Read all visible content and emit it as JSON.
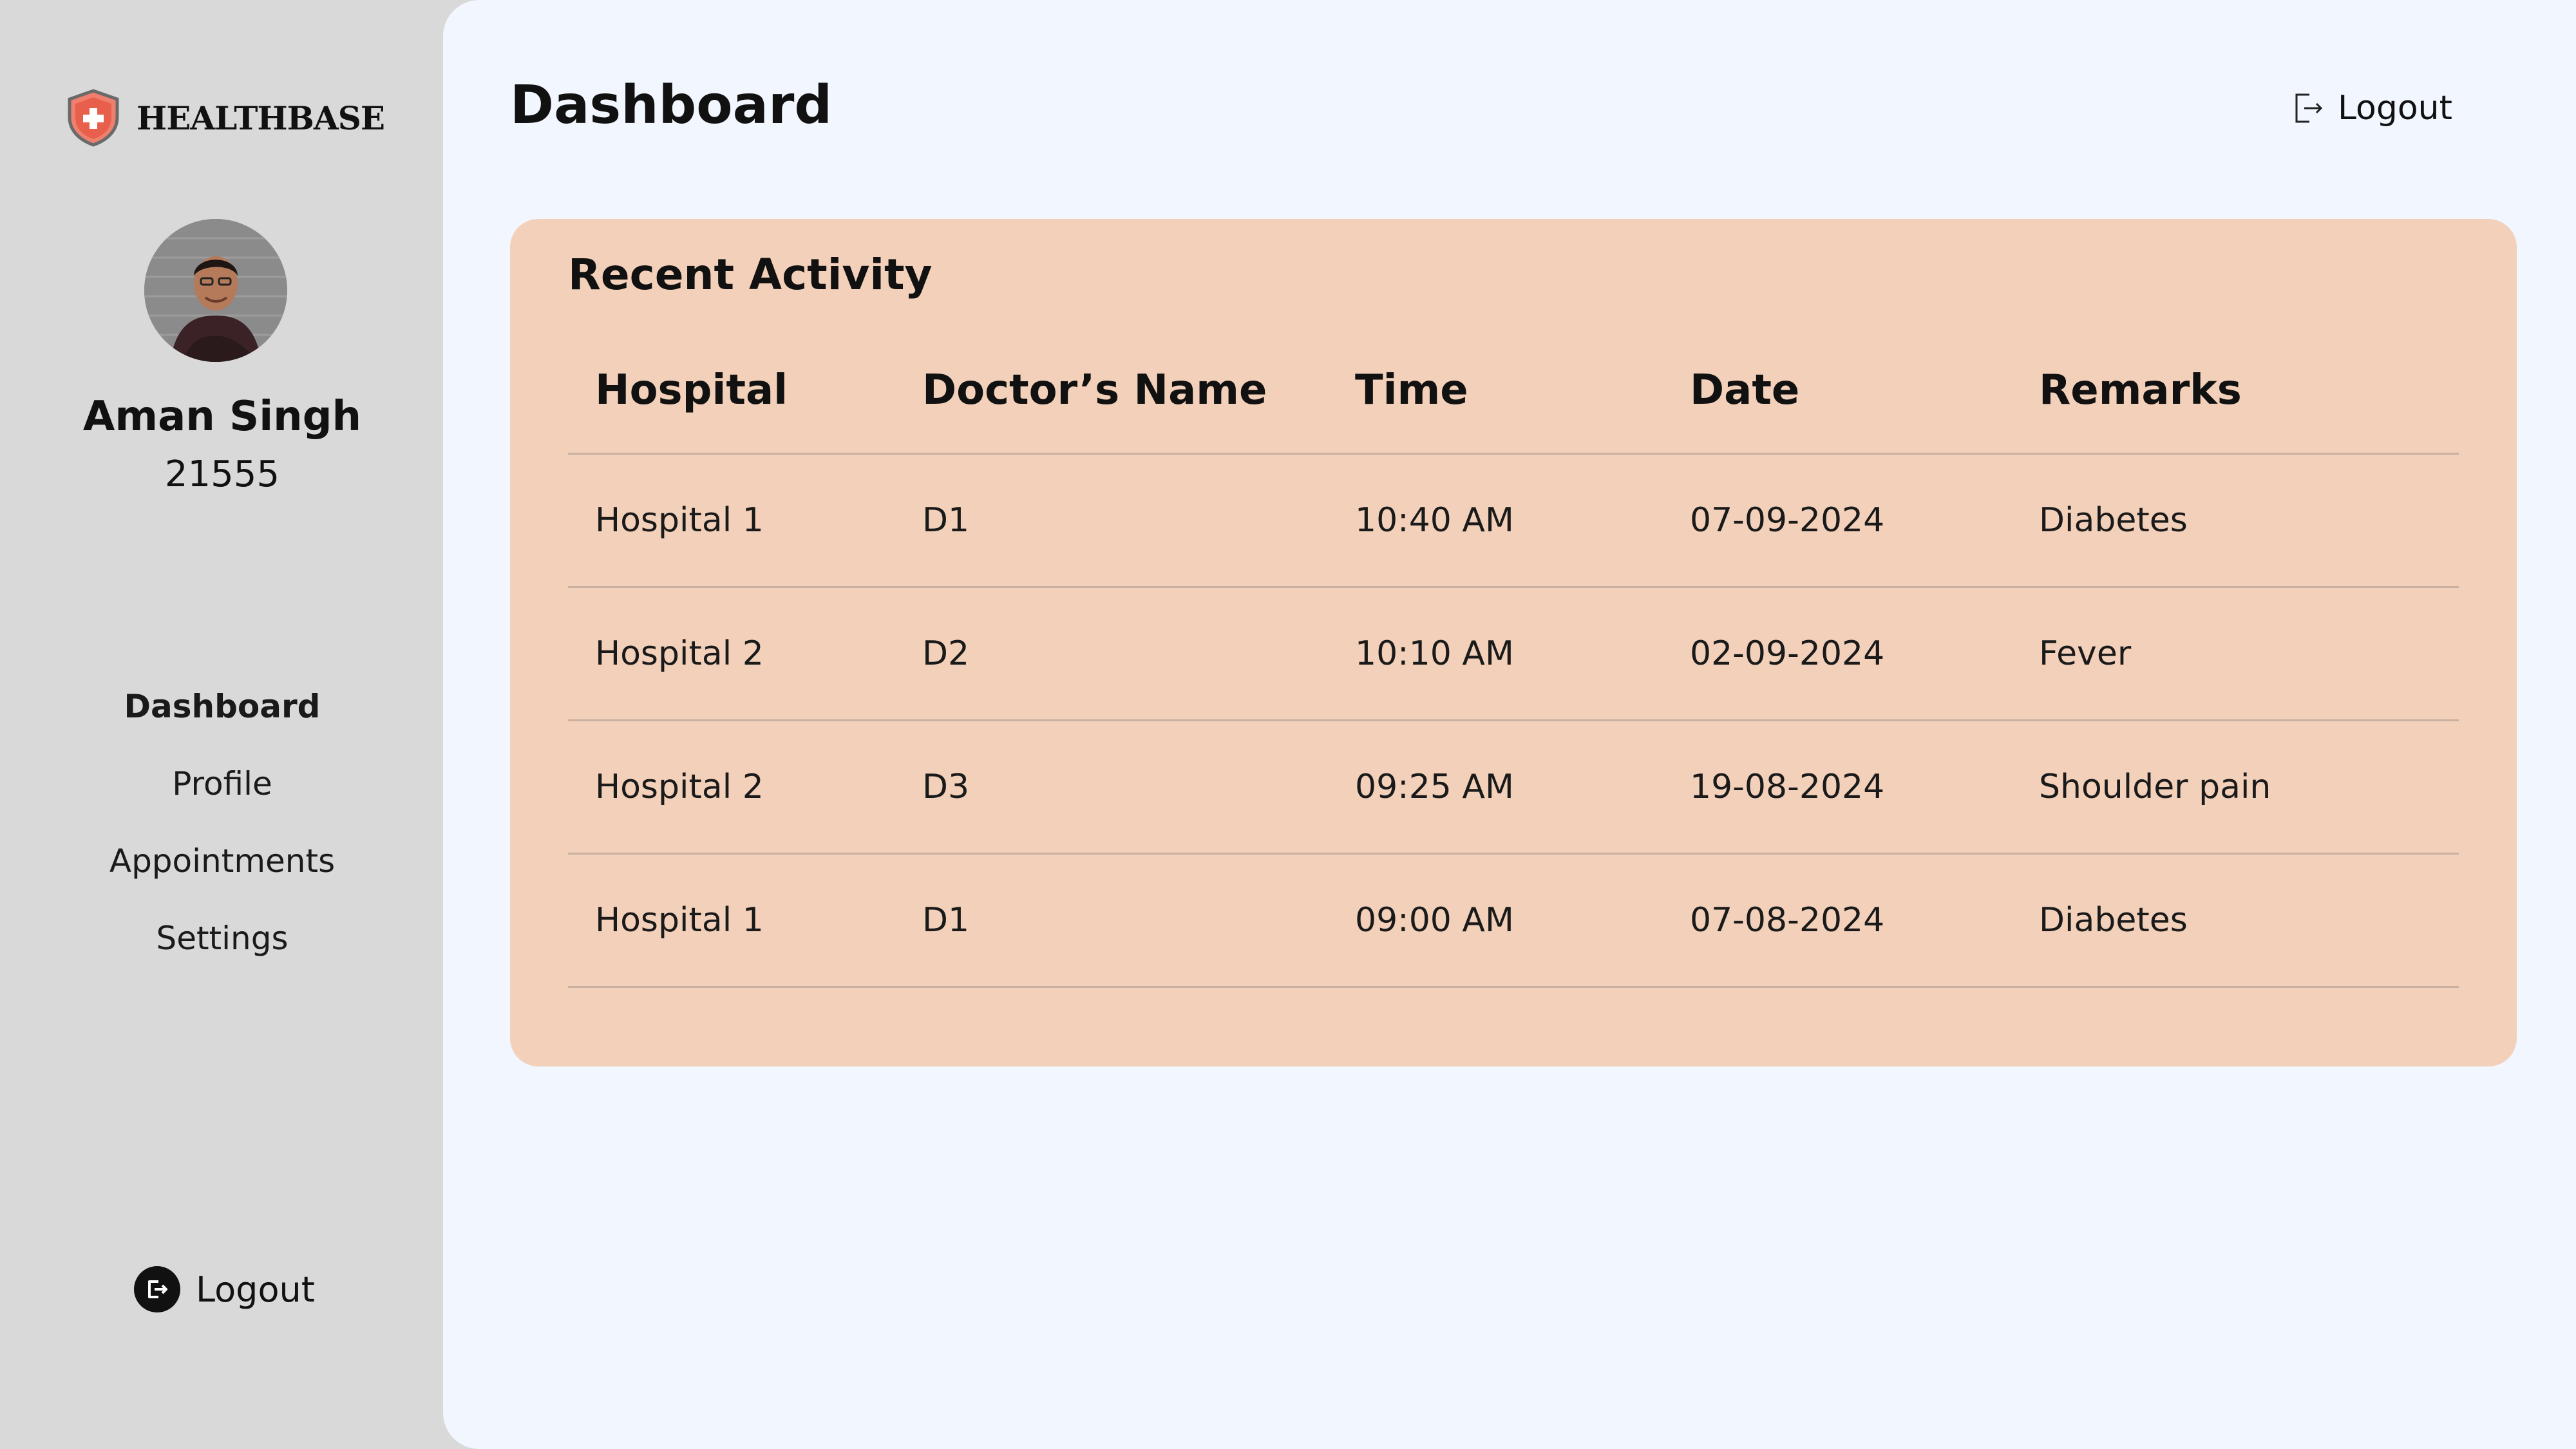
{
  "brand": {
    "name": "HEALTHBASE",
    "icon": "shield-cross-icon",
    "accent": "#e8604c"
  },
  "user": {
    "name": "Aman Singh",
    "id": "21555"
  },
  "nav": {
    "items": [
      {
        "label": "Dashboard",
        "active": true
      },
      {
        "label": "Profile",
        "active": false
      },
      {
        "label": "Appointments",
        "active": false
      },
      {
        "label": "Settings",
        "active": false
      }
    ],
    "logout_label": "Logout"
  },
  "header": {
    "title": "Dashboard",
    "logout_label": "Logout"
  },
  "recent_activity": {
    "title": "Recent Activity",
    "columns": [
      "Hospital",
      "Doctor’s Name",
      "Time",
      "Date",
      "Remarks"
    ],
    "rows": [
      [
        "Hospital 1",
        "D1",
        "10:40 AM",
        "07-09-2024",
        "Diabetes"
      ],
      [
        "Hospital 2",
        "D2",
        "10:10 AM",
        "02-09-2024",
        "Fever"
      ],
      [
        "Hospital 2",
        "D3",
        "09:25 AM",
        "19-08-2024",
        "Shoulder pain"
      ],
      [
        "Hospital 1",
        "D1",
        "09:00 AM",
        "07-08-2024",
        "Diabetes"
      ]
    ]
  },
  "colors": {
    "sidebar_bg": "#d9d9d9",
    "main_bg": "#f1f6ff",
    "card_bg": "#f3d0ba"
  }
}
